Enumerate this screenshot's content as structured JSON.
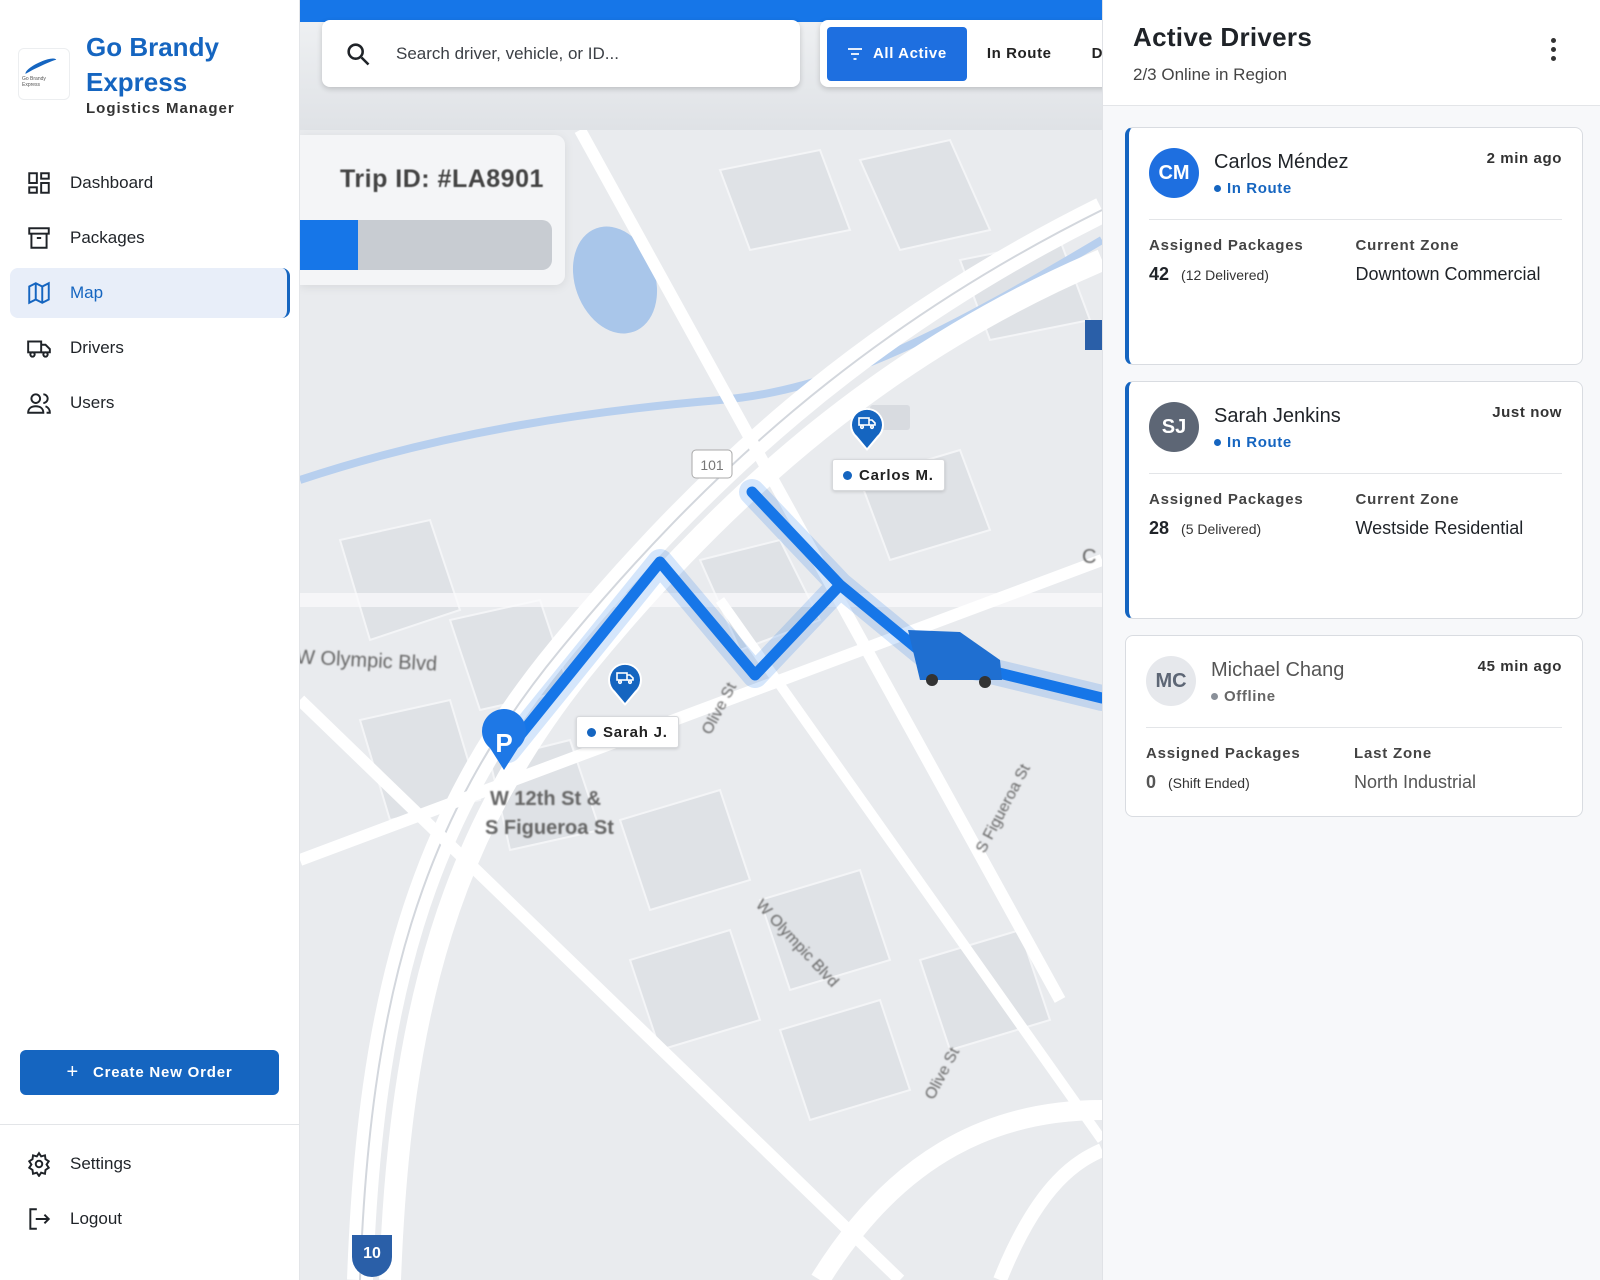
{
  "brand": {
    "name": "Go Brandy Express",
    "subtitle": "Logistics Manager",
    "logo_text": "Go Brandy Express"
  },
  "nav": {
    "items": [
      {
        "label": "Dashboard",
        "icon": "dashboard-icon"
      },
      {
        "label": "Packages",
        "icon": "archive-icon"
      },
      {
        "label": "Map",
        "icon": "map-icon",
        "active": true
      },
      {
        "label": "Drivers",
        "icon": "truck-icon"
      },
      {
        "label": "Users",
        "icon": "users-icon"
      }
    ],
    "create_order": "Create New Order",
    "settings": "Settings",
    "logout": "Logout"
  },
  "map": {
    "search_placeholder": "Search driver, vehicle, or ID...",
    "filters": [
      "All Active",
      "In Route",
      "D"
    ],
    "trip_id": "Trip ID: #LA8901",
    "trip_progress": 0.23,
    "markers": {
      "carlos": "Carlos M.",
      "sarah": "Sarah J."
    },
    "streets": {
      "olympic": "W Olympic Blvd",
      "olympic2": "W Olympic Blvd",
      "twelfth": "W 12th St &",
      "figueroa": "S Figueroa St",
      "figueroa2": "S Figueroa St",
      "olive": "Olive St",
      "olive2": "Olive St",
      "hwy101": "101",
      "hwy10": "10",
      "partial_c": "C"
    },
    "colors": {
      "route": "#1676e8",
      "marker": "#1565c0"
    }
  },
  "panel": {
    "title": "Active Drivers",
    "subtitle": "2/3 Online in Region",
    "drivers": [
      {
        "initials": "CM",
        "name": "Carlos Méndez",
        "status": "In Route",
        "ago": "2 min ago",
        "packages_label": "Assigned Packages",
        "packages": "42",
        "delivered": "(12 Delivered)",
        "zone_label": "Current Zone",
        "zone": "Downtown Commercial",
        "avatar_color": "#1e6fe0"
      },
      {
        "initials": "SJ",
        "name": "Sarah Jenkins",
        "status": "In Route",
        "ago": "Just now",
        "packages_label": "Assigned Packages",
        "packages": "28",
        "delivered": "(5 Delivered)",
        "zone_label": "Current Zone",
        "zone": "Westside Residential",
        "avatar_color": "#5d6675"
      },
      {
        "initials": "MC",
        "name": "Michael Chang",
        "status": "Offline",
        "ago": "45 min ago",
        "packages_label": "Assigned Packages",
        "packages": "0",
        "delivered": "(Shift Ended)",
        "zone_label": "Last Zone",
        "zone": "North Industrial",
        "avatar_color": "#e6e8ec"
      }
    ]
  }
}
